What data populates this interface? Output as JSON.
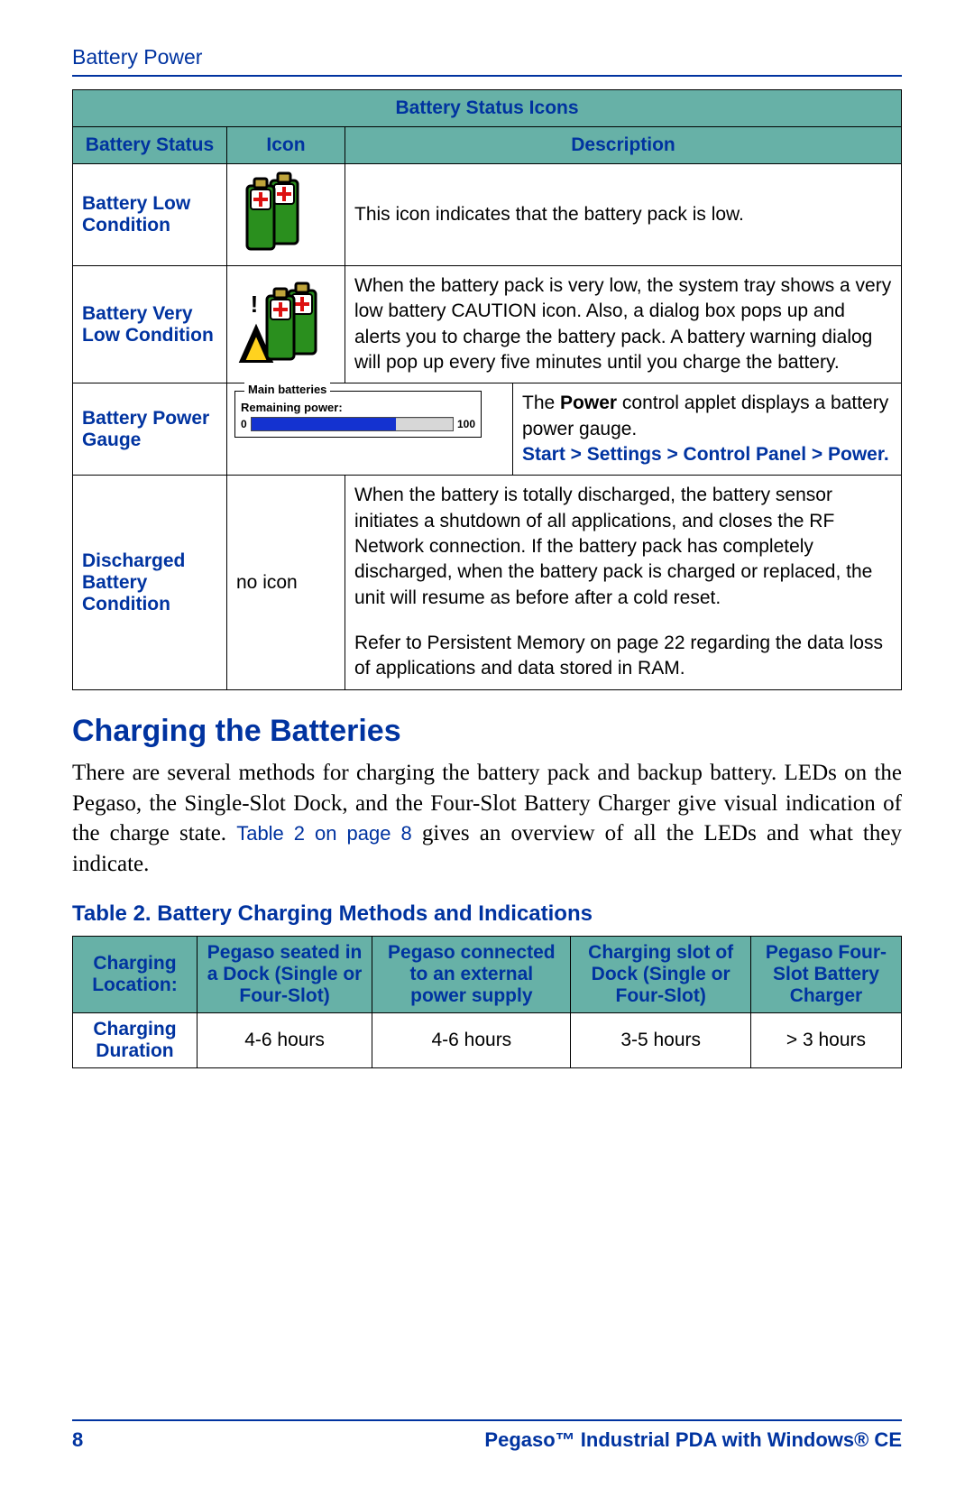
{
  "section_title": "Battery Power",
  "status_table": {
    "caption": "Battery Status Icons",
    "headers": {
      "status": "Battery Status",
      "icon": "Icon",
      "description": "Description"
    },
    "rows": [
      {
        "status": "Battery Low Condition",
        "icon_name": "batt-low-icon",
        "description": "This icon indicates that the battery pack is low."
      },
      {
        "status": "Battery Very Low Condition",
        "icon_name": "batt-very-low-icon",
        "description": "When the battery pack is very low, the system tray shows a very low battery CAUTION icon. Also, a dialog box pops up and alerts you to charge the battery pack. A battery warning dialog will pop up every five minutes until you charge the battery."
      },
      {
        "status": "Battery Power Gauge",
        "icon_name": "power-gauge",
        "gauge": {
          "title": "Main batteries",
          "subtitle": "Remaining power:",
          "min": "0",
          "max": "100"
        },
        "description_pre": "The ",
        "description_bold": "Power",
        "description_post": " control applet displays a battery power gauge.",
        "path": "Start > Settings > Control Panel > Power."
      },
      {
        "status": "Discharged Battery Condition",
        "icon_text": "no icon",
        "description_p1": "When the battery is totally discharged, the battery sensor initiates a shutdown of all applications, and closes the RF Network connection. If the battery pack has completely discharged, when the battery pack is charged or replaced, the unit will resume as before after a cold reset.",
        "description_p2": "Refer to Persistent Memory on page 22 regarding the data loss of applications and data stored in RAM."
      }
    ]
  },
  "h2": "Charging the Batteries",
  "para1_a": "There are several methods for charging the battery pack and backup battery. LEDs on the Pegaso, the Single-Slot Dock, and the Four-Slot Battery Charger give visual indication of the charge state. ",
  "para1_link": "Table 2 on page 8",
  "para1_b": " gives an overview of all the LEDs and what they indicate.",
  "table2_title": "Table 2. Battery Charging Methods and Indications",
  "charge_table": {
    "headers": [
      "Charging Location:",
      "Pegaso seated in a Dock (Single or Four-Slot)",
      "Pegaso connected to an external power supply",
      "Charging slot of Dock (Single or Four-Slot)",
      "Pegaso Four-Slot Battery Charger"
    ],
    "row_label": "Charging Duration",
    "row_values": [
      "4-6 hours",
      "4-6 hours",
      "3-5 hours",
      "> 3 hours"
    ]
  },
  "footer": {
    "page": "8",
    "product": "Pegaso™ Industrial PDA with Windows® CE"
  }
}
